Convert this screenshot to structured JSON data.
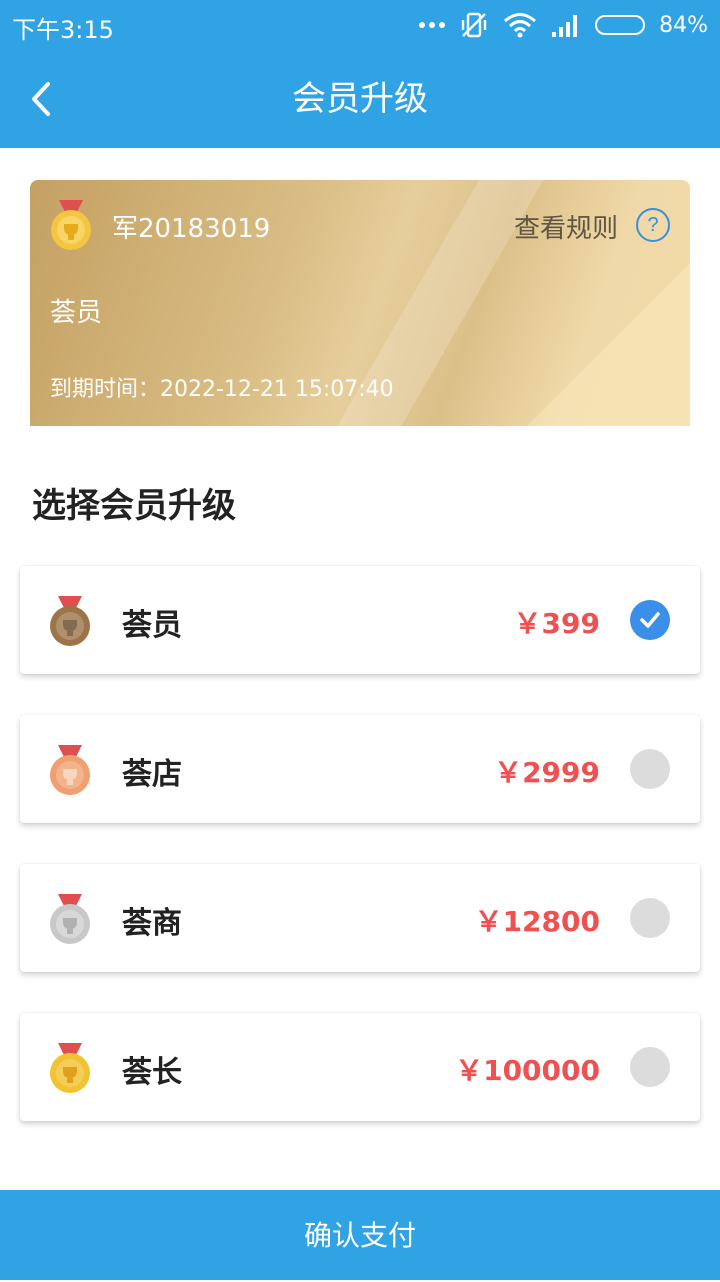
{
  "status_bar": {
    "time": "下午3:15",
    "battery": "84%",
    "battery_level": 0.84
  },
  "header": {
    "title": "会员升级"
  },
  "member_card": {
    "name": "军20183019",
    "rules_link": "查看规则",
    "help_symbol": "?",
    "level": "荟员",
    "expire": "到期时间：2022-12-21 15:07:40"
  },
  "section_title": "选择会员升级",
  "options": [
    {
      "name": "荟员",
      "price": "￥399",
      "selected": true,
      "medal_color": "#9c7448"
    },
    {
      "name": "荟店",
      "price": "￥2999",
      "selected": false,
      "medal_color": "#f0a070"
    },
    {
      "name": "荟商",
      "price": "￥12800",
      "selected": false,
      "medal_color": "#c8c8c8"
    },
    {
      "name": "荟长",
      "price": "￥100000",
      "selected": false,
      "medal_color": "#f2c230"
    }
  ],
  "confirm_button": "确认支付",
  "colors": {
    "primary": "#2fa3e3",
    "price": "#f05050",
    "check": "#3a8fe8"
  }
}
